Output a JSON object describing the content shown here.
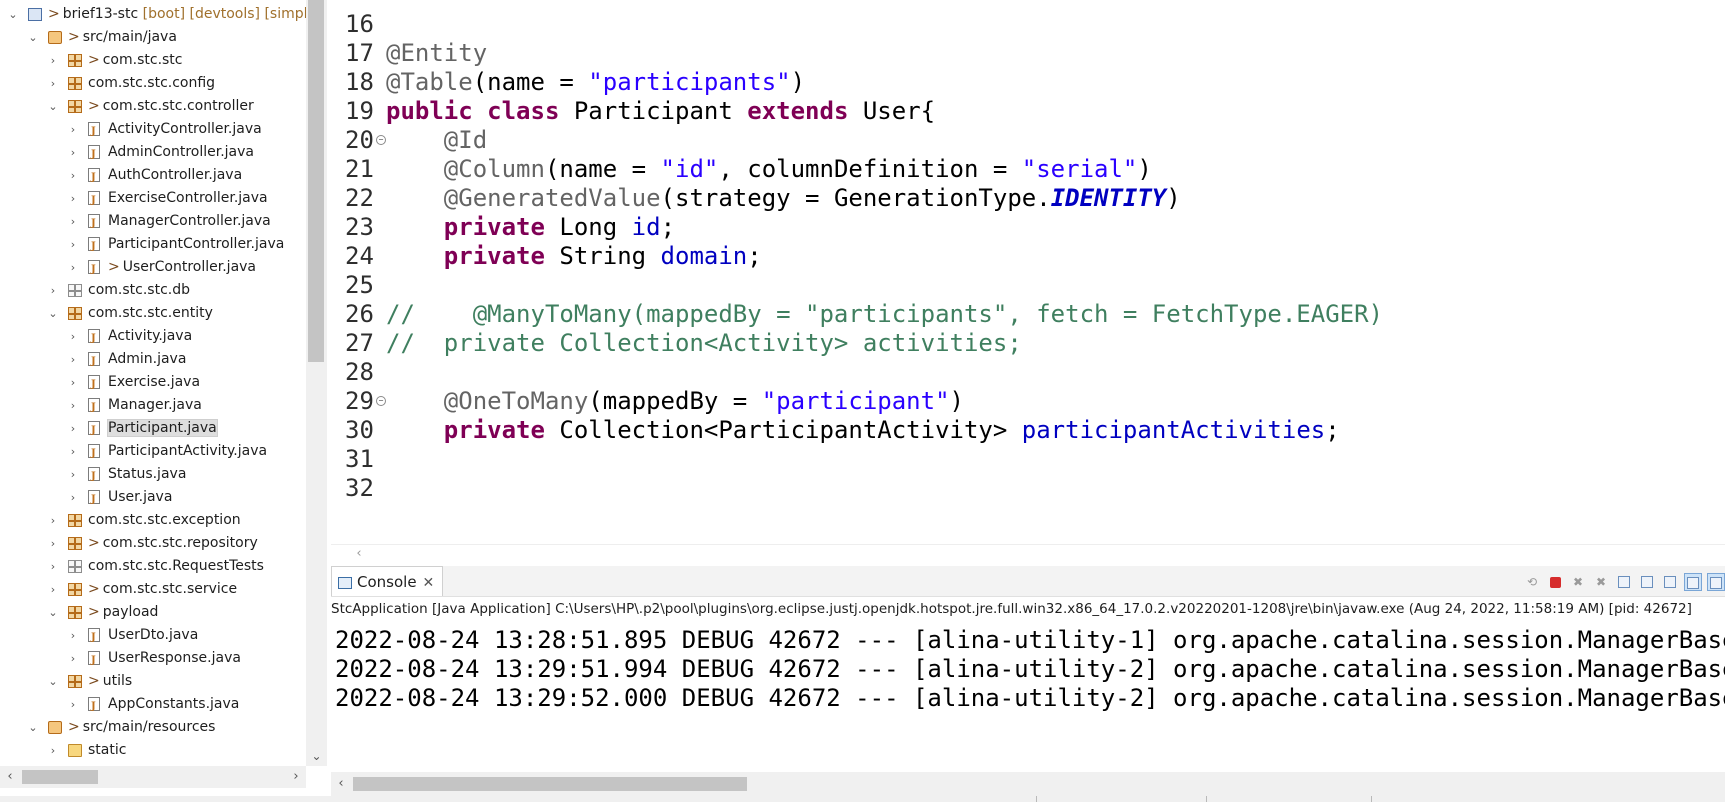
{
  "explorer": {
    "items": [
      {
        "label": "brief13-stc",
        "gt": ">",
        "decor": " [boot] [devtools] [simplon",
        "twisty": "expanded",
        "icon": "project-icon",
        "indent": 0
      },
      {
        "label": "src/main/java",
        "gt": ">",
        "decor": "",
        "twisty": "expanded",
        "icon": "source-folder-icon",
        "indent": 1
      },
      {
        "label": "com.stc.stc",
        "gt": ">",
        "decor": "",
        "twisty": "collapsed",
        "icon": "package-icon",
        "indent": 2
      },
      {
        "label": "com.stc.stc.config",
        "gt": "",
        "decor": "",
        "twisty": "collapsed",
        "icon": "package-icon",
        "indent": 2
      },
      {
        "label": "com.stc.stc.controller",
        "gt": ">",
        "decor": "",
        "twisty": "expanded",
        "icon": "package-icon",
        "indent": 2
      },
      {
        "label": "ActivityController.java",
        "gt": "",
        "decor": "",
        "twisty": "collapsed",
        "icon": "java-file-icon",
        "indent": 3
      },
      {
        "label": "AdminController.java",
        "gt": "",
        "decor": "",
        "twisty": "collapsed",
        "icon": "java-file-icon",
        "indent": 3
      },
      {
        "label": "AuthController.java",
        "gt": "",
        "decor": "",
        "twisty": "collapsed",
        "icon": "java-file-icon",
        "indent": 3
      },
      {
        "label": "ExerciseController.java",
        "gt": "",
        "decor": "",
        "twisty": "collapsed",
        "icon": "java-file-icon",
        "indent": 3
      },
      {
        "label": "ManagerController.java",
        "gt": "",
        "decor": "",
        "twisty": "collapsed",
        "icon": "java-file-icon",
        "indent": 3
      },
      {
        "label": "ParticipantController.java",
        "gt": "",
        "decor": "",
        "twisty": "collapsed",
        "icon": "java-file-icon",
        "indent": 3
      },
      {
        "label": "UserController.java",
        "gt": ">",
        "decor": "",
        "twisty": "collapsed",
        "icon": "java-file-icon",
        "indent": 3
      },
      {
        "label": "com.stc.stc.db",
        "gt": "",
        "decor": "",
        "twisty": "collapsed",
        "icon": "empty-package-icon",
        "indent": 2
      },
      {
        "label": "com.stc.stc.entity",
        "gt": "",
        "decor": "",
        "twisty": "expanded",
        "icon": "package-icon",
        "indent": 2
      },
      {
        "label": "Activity.java",
        "gt": "",
        "decor": "",
        "twisty": "collapsed",
        "icon": "java-file-icon",
        "indent": 3
      },
      {
        "label": "Admin.java",
        "gt": "",
        "decor": "",
        "twisty": "collapsed",
        "icon": "java-file-icon",
        "indent": 3
      },
      {
        "label": "Exercise.java",
        "gt": "",
        "decor": "",
        "twisty": "collapsed",
        "icon": "java-file-icon",
        "indent": 3
      },
      {
        "label": "Manager.java",
        "gt": "",
        "decor": "",
        "twisty": "collapsed",
        "icon": "java-file-icon",
        "indent": 3
      },
      {
        "label": "Participant.java",
        "gt": "",
        "decor": "",
        "twisty": "collapsed",
        "icon": "java-file-icon",
        "indent": 3,
        "selected": true
      },
      {
        "label": "ParticipantActivity.java",
        "gt": "",
        "decor": "",
        "twisty": "collapsed",
        "icon": "java-file-icon",
        "indent": 3
      },
      {
        "label": "Status.java",
        "gt": "",
        "decor": "",
        "twisty": "collapsed",
        "icon": "java-file-icon",
        "indent": 3
      },
      {
        "label": "User.java",
        "gt": "",
        "decor": "",
        "twisty": "collapsed",
        "icon": "java-file-icon",
        "indent": 3
      },
      {
        "label": "com.stc.stc.exception",
        "gt": "",
        "decor": "",
        "twisty": "collapsed",
        "icon": "package-icon",
        "indent": 2
      },
      {
        "label": "com.stc.stc.repository",
        "gt": ">",
        "decor": "",
        "twisty": "collapsed",
        "icon": "package-icon",
        "indent": 2
      },
      {
        "label": "com.stc.stc.RequestTests",
        "gt": "",
        "decor": "",
        "twisty": "collapsed",
        "icon": "empty-package-icon",
        "indent": 2
      },
      {
        "label": "com.stc.stc.service",
        "gt": ">",
        "decor": "",
        "twisty": "collapsed",
        "icon": "package-icon",
        "indent": 2
      },
      {
        "label": "payload",
        "gt": ">",
        "decor": "",
        "twisty": "expanded",
        "icon": "package-icon",
        "indent": 2
      },
      {
        "label": "UserDto.java",
        "gt": "",
        "decor": "",
        "twisty": "collapsed",
        "icon": "java-file-icon",
        "indent": 3
      },
      {
        "label": "UserResponse.java",
        "gt": "",
        "decor": "",
        "twisty": "collapsed",
        "icon": "java-file-icon",
        "indent": 3
      },
      {
        "label": "utils",
        "gt": ">",
        "decor": "",
        "twisty": "expanded",
        "icon": "package-icon",
        "indent": 2
      },
      {
        "label": "AppConstants.java",
        "gt": "",
        "decor": "",
        "twisty": "collapsed",
        "icon": "java-file-icon",
        "indent": 3
      },
      {
        "label": "src/main/resources",
        "gt": ">",
        "decor": "",
        "twisty": "expanded",
        "icon": "source-folder-icon",
        "indent": 1
      },
      {
        "label": "static",
        "gt": "",
        "decor": "",
        "twisty": "collapsed",
        "icon": "folder-icon",
        "indent": 2
      }
    ]
  },
  "editor": {
    "lines": [
      {
        "num": "16",
        "fold": false,
        "tokens": []
      },
      {
        "num": "17",
        "fold": false,
        "tokens": [
          {
            "t": "an",
            "v": "@Entity"
          }
        ]
      },
      {
        "num": "18",
        "fold": false,
        "tokens": [
          {
            "t": "an",
            "v": "@Table"
          },
          {
            "t": "",
            "v": "(name = "
          },
          {
            "t": "str",
            "v": "\"participants\""
          },
          {
            "t": "",
            "v": ")"
          }
        ]
      },
      {
        "num": "19",
        "fold": false,
        "tokens": [
          {
            "t": "kw",
            "v": "public"
          },
          {
            "t": "",
            "v": " "
          },
          {
            "t": "kw",
            "v": "class"
          },
          {
            "t": "",
            "v": " Participant "
          },
          {
            "t": "kw",
            "v": "extends"
          },
          {
            "t": "",
            "v": " User{"
          }
        ]
      },
      {
        "num": "20",
        "fold": true,
        "tokens": [
          {
            "t": "",
            "v": "    "
          },
          {
            "t": "an",
            "v": "@Id"
          }
        ]
      },
      {
        "num": "21",
        "fold": false,
        "tokens": [
          {
            "t": "",
            "v": "    "
          },
          {
            "t": "an",
            "v": "@Column"
          },
          {
            "t": "",
            "v": "(name = "
          },
          {
            "t": "str",
            "v": "\"id\""
          },
          {
            "t": "",
            "v": ", columnDefinition = "
          },
          {
            "t": "str",
            "v": "\"serial\""
          },
          {
            "t": "",
            "v": ")"
          }
        ]
      },
      {
        "num": "22",
        "fold": false,
        "tokens": [
          {
            "t": "",
            "v": "    "
          },
          {
            "t": "an",
            "v": "@GeneratedValue"
          },
          {
            "t": "",
            "v": "(strategy = GenerationType."
          },
          {
            "t": "const",
            "v": "IDENTITY"
          },
          {
            "t": "",
            "v": ")"
          }
        ]
      },
      {
        "num": "23",
        "fold": false,
        "tokens": [
          {
            "t": "",
            "v": "    "
          },
          {
            "t": "kw",
            "v": "private"
          },
          {
            "t": "",
            "v": " Long "
          },
          {
            "t": "fld",
            "v": "id"
          },
          {
            "t": "",
            "v": ";"
          }
        ]
      },
      {
        "num": "24",
        "fold": false,
        "tokens": [
          {
            "t": "",
            "v": "    "
          },
          {
            "t": "kw",
            "v": "private"
          },
          {
            "t": "",
            "v": " String "
          },
          {
            "t": "fld",
            "v": "domain"
          },
          {
            "t": "",
            "v": ";"
          }
        ]
      },
      {
        "num": "25",
        "fold": false,
        "tokens": []
      },
      {
        "num": "26",
        "fold": false,
        "tokens": [
          {
            "t": "cm",
            "v": "//    @ManyToMany(mappedBy = \"participants\", fetch = FetchType.EAGER)"
          }
        ]
      },
      {
        "num": "27",
        "fold": false,
        "tokens": [
          {
            "t": "cm",
            "v": "//  private Collection<Activity> activities;"
          }
        ]
      },
      {
        "num": "28",
        "fold": false,
        "tokens": []
      },
      {
        "num": "29",
        "fold": true,
        "tokens": [
          {
            "t": "",
            "v": "    "
          },
          {
            "t": "an",
            "v": "@OneToMany"
          },
          {
            "t": "",
            "v": "(mappedBy = "
          },
          {
            "t": "str",
            "v": "\"participant\""
          },
          {
            "t": "",
            "v": ")"
          }
        ]
      },
      {
        "num": "30",
        "fold": false,
        "tokens": [
          {
            "t": "",
            "v": "    "
          },
          {
            "t": "kw",
            "v": "private"
          },
          {
            "t": "",
            "v": " Collection<ParticipantActivity> "
          },
          {
            "t": "fld",
            "v": "participantActivities"
          },
          {
            "t": "",
            "v": ";"
          }
        ]
      },
      {
        "num": "31",
        "fold": false,
        "tokens": []
      },
      {
        "num": "32",
        "fold": false,
        "tokens": []
      }
    ]
  },
  "console": {
    "tab_label": "Console",
    "close_glyph": "✕",
    "description": "StcApplication [Java Application] C:\\Users\\HP\\.p2\\pool\\plugins\\org.eclipse.justj.openjdk.hotspot.jre.full.win32.x86_64_17.0.2.v20220201-1208\\jre\\bin\\javaw.exe  (Aug 24, 2022, 11:58:19 AM) [pid: 42672]",
    "output": [
      "2022-08-24 13:28:51.895 DEBUG 42672 --- [alina-utility-1] org.apache.catalina.session.ManagerBase",
      "2022-08-24 13:29:51.994 DEBUG 42672 --- [alina-utility-2] org.apache.catalina.session.ManagerBase",
      "2022-08-24 13:29:52.000 DEBUG 42672 --- [alina-utility-2] org.apache.catalina.session.ManagerBase"
    ],
    "toolbar": [
      "pin-console-icon",
      "terminate-icon",
      "remove-launch-icon",
      "remove-all-launches-icon",
      "clear-console-icon",
      "scroll-lock-icon",
      "word-wrap-icon",
      "show-on-output-icon",
      "display-console-icon"
    ]
  },
  "colors": {
    "keyword": "#7f0055",
    "annotation": "#646464",
    "string": "#2a00ff",
    "field": "#0000c0",
    "comment": "#3f7f5f"
  }
}
